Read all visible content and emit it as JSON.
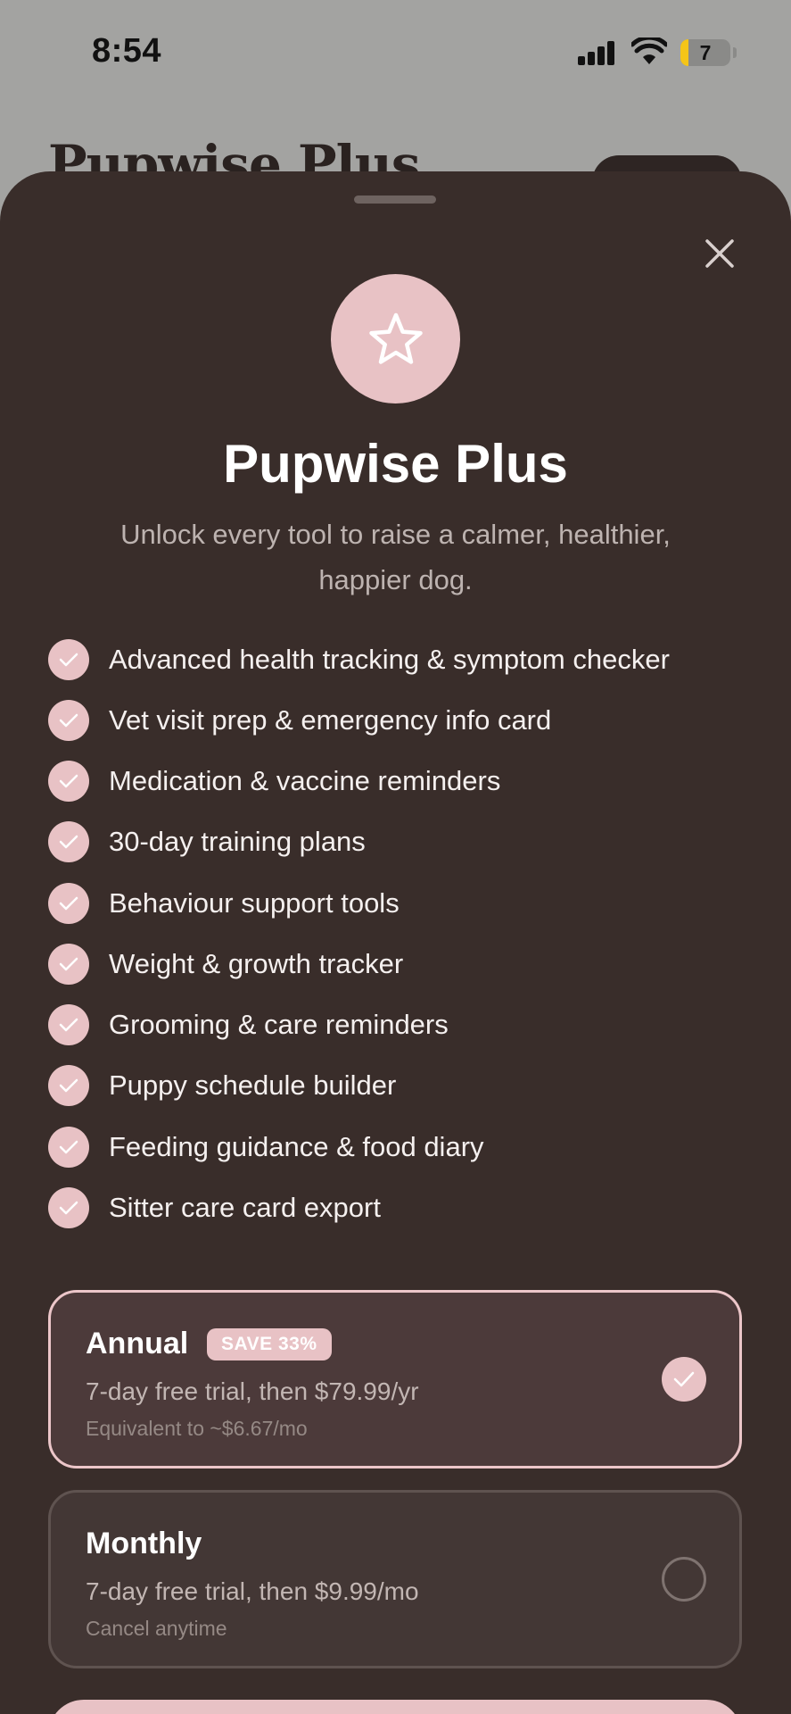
{
  "status_bar": {
    "time": "8:54",
    "battery_level": "7"
  },
  "background": {
    "title": "Pupwise Plus"
  },
  "paywall": {
    "icon": "star-icon",
    "title": "Pupwise Plus",
    "subtitle": "Unlock every tool to raise a calmer, healthier, happier dog.",
    "features": [
      "Advanced health tracking & symptom checker",
      "Vet visit prep & emergency info card",
      "Medication & vaccine reminders",
      "30-day training plans",
      "Behaviour support tools",
      "Weight & growth tracker",
      "Grooming & care reminders",
      "Puppy schedule builder",
      "Feeding guidance & food diary",
      "Sitter care card export"
    ],
    "plans": {
      "annual": {
        "name": "Annual",
        "badge": "SAVE 33%",
        "price_line": "7-day free trial, then $79.99/yr",
        "sub_line": "Equivalent to ~$6.67/mo",
        "selected": true
      },
      "monthly": {
        "name": "Monthly",
        "price_line": "7-day free trial, then $9.99/mo",
        "sub_line": "Cancel anytime",
        "selected": false
      }
    }
  },
  "colors": {
    "sheet": "#392d2a",
    "accent_pink": "#e8c2c5",
    "selected_plan_bg": "#4c3a3a"
  }
}
